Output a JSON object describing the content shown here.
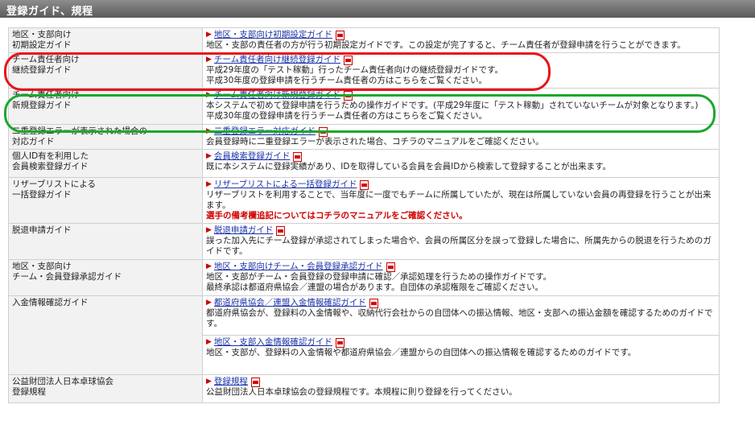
{
  "header": {
    "title": "登録ガイド、規程"
  },
  "rows": [
    {
      "label": "地区・支部向け\n初期設定ガイド",
      "entries": [
        {
          "link": "地区・支部向け初期設定ガイド",
          "desc": "地区・支部の責任者の方が行う初期設定ガイドです。この設定が完了すると、チーム責任者が登録申請を行うことができます。"
        }
      ]
    },
    {
      "label": "チーム責任者向け\n継続登録ガイド",
      "entries": [
        {
          "link": "チーム責任者向け継続登録ガイド",
          "desc": "平成29年度の「テスト稼動」行ったチーム責任者向けの継続登録ガイドです。\n平成30年度の登録申請を行うチーム責任者の方はこちらをご覧ください。"
        }
      ]
    },
    {
      "label": "チーム責任者向け\n新規登録ガイド",
      "entries": [
        {
          "link": "チーム責任者向け新規登録ガイド",
          "desc": "本システムで初めて登録申請を行うための操作ガイドです。(平成29年度に「テスト稼動」されていないチームが対象となります。)\n平成30年度の登録申請を行うチーム責任者の方はこちらをご覧ください。"
        }
      ]
    },
    {
      "label": "二重登録エラーが表示された場合の\n対応ガイド",
      "entries": [
        {
          "link": "二重登録エラー対応ガイド",
          "desc": "会員登録時に二重登録エラーが表示された場合、コチラのマニュアルをご確認ください。"
        }
      ]
    },
    {
      "label": "個人ID有を利用した\n会員検索登録ガイド",
      "entries": [
        {
          "link": "会員検索登録ガイド",
          "desc": "既に本システムに登録実績があり、IDを取得している会員を会員IDから検索して登録することが出来ます。"
        }
      ]
    },
    {
      "label": "リザーブリストによる\n一括登録ガイド",
      "entries": [
        {
          "link": "リザーブリストによる一括登録ガイド",
          "desc": "リザーブリストを利用することで、当年度に一度でもチームに所属していたが、現在は所属していない会員の再登録を行うことが出来ます。",
          "warning": "選手の備考欄追記についてはコチラのマニュアルをご確認ください。"
        }
      ]
    },
    {
      "label": "脱退申請ガイド",
      "entries": [
        {
          "link": "脱退申請ガイド",
          "desc": "誤った加入先にチーム登録が承認されてしまった場合や、会員の所属区分を誤って登録した場合に、所属先からの脱退を行うためのガイドです。"
        }
      ]
    },
    {
      "label": "地区・支部向け\nチーム・会員登録承認ガイド",
      "entries": [
        {
          "link": "地区・支部向けチーム・会員登録承認ガイド",
          "desc": "地区・支部がチーム・会員登録の登録申請に確認／承認処理を行うための操作ガイドです。\n最終承認は都道府県協会／連盟の場合があります。自団体の承認権限をご確認ください。"
        }
      ]
    },
    {
      "label": "入金情報確認ガイド",
      "entries": [
        {
          "link": "都道府県協会／連盟入金情報確認ガイド",
          "desc": "都道府県協会が、登録料の入金情報や、収納代行会社からの自団体への振込情報、地区・支部への振込金額を確認するためのガイドです。"
        },
        {
          "link": "地区・支部入金情報確認ガイド",
          "desc": "地区・支部が、登録料の入金情報や都道府県協会／連盟からの自団体への振込情報を確認するためのガイドです。"
        }
      ]
    },
    {
      "label": "公益財団法人日本卓球協会\n登録規程",
      "entries": [
        {
          "link": "登録規程",
          "desc": "公益財団法人日本卓球協会の登録規程です。本規程に則り登録を行ってください。"
        }
      ]
    }
  ],
  "annotations": {
    "red_oval_color": "#e8121a",
    "green_oval_color": "#1aa82c"
  },
  "icons": {
    "pdf": "pdf-icon",
    "link_arrow": "arrow-right-icon"
  }
}
